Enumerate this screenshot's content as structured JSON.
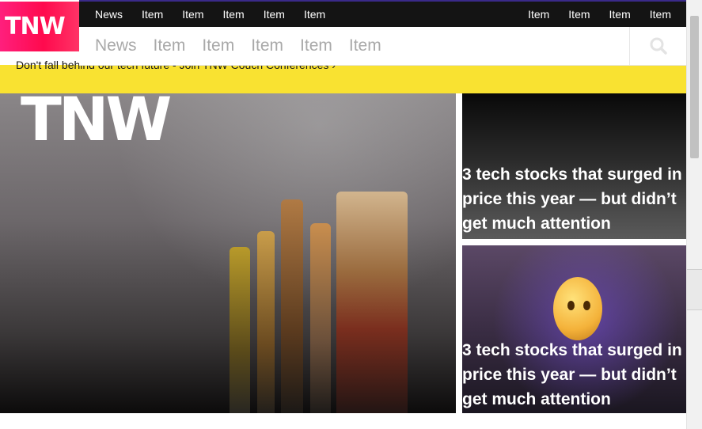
{
  "brand": {
    "logo_text": "TNW",
    "accent": "#ff0a4d",
    "banner_color": "#f9e231"
  },
  "top_nav": {
    "left_items": [
      "News",
      "Item",
      "Item",
      "Item",
      "Item",
      "Item"
    ],
    "right_items": [
      "Item",
      "Item",
      "Item",
      "Item"
    ]
  },
  "sub_nav": {
    "items": [
      "News",
      "Item",
      "Item",
      "Item",
      "Item",
      "Item"
    ],
    "search_icon": "search-icon"
  },
  "banner": {
    "text": "Don't fall behind our tech future - Join TNW Couch Conferences",
    "arrow_icon": "chevron-right-icon"
  },
  "hero": {
    "logo_text": "TNW"
  },
  "cards": [
    {
      "title": "3 tech stocks that surged in price this year — but didn’t get much attention"
    },
    {
      "title": "3 tech stocks that surged in price this year — but didn’t get much attention"
    }
  ]
}
